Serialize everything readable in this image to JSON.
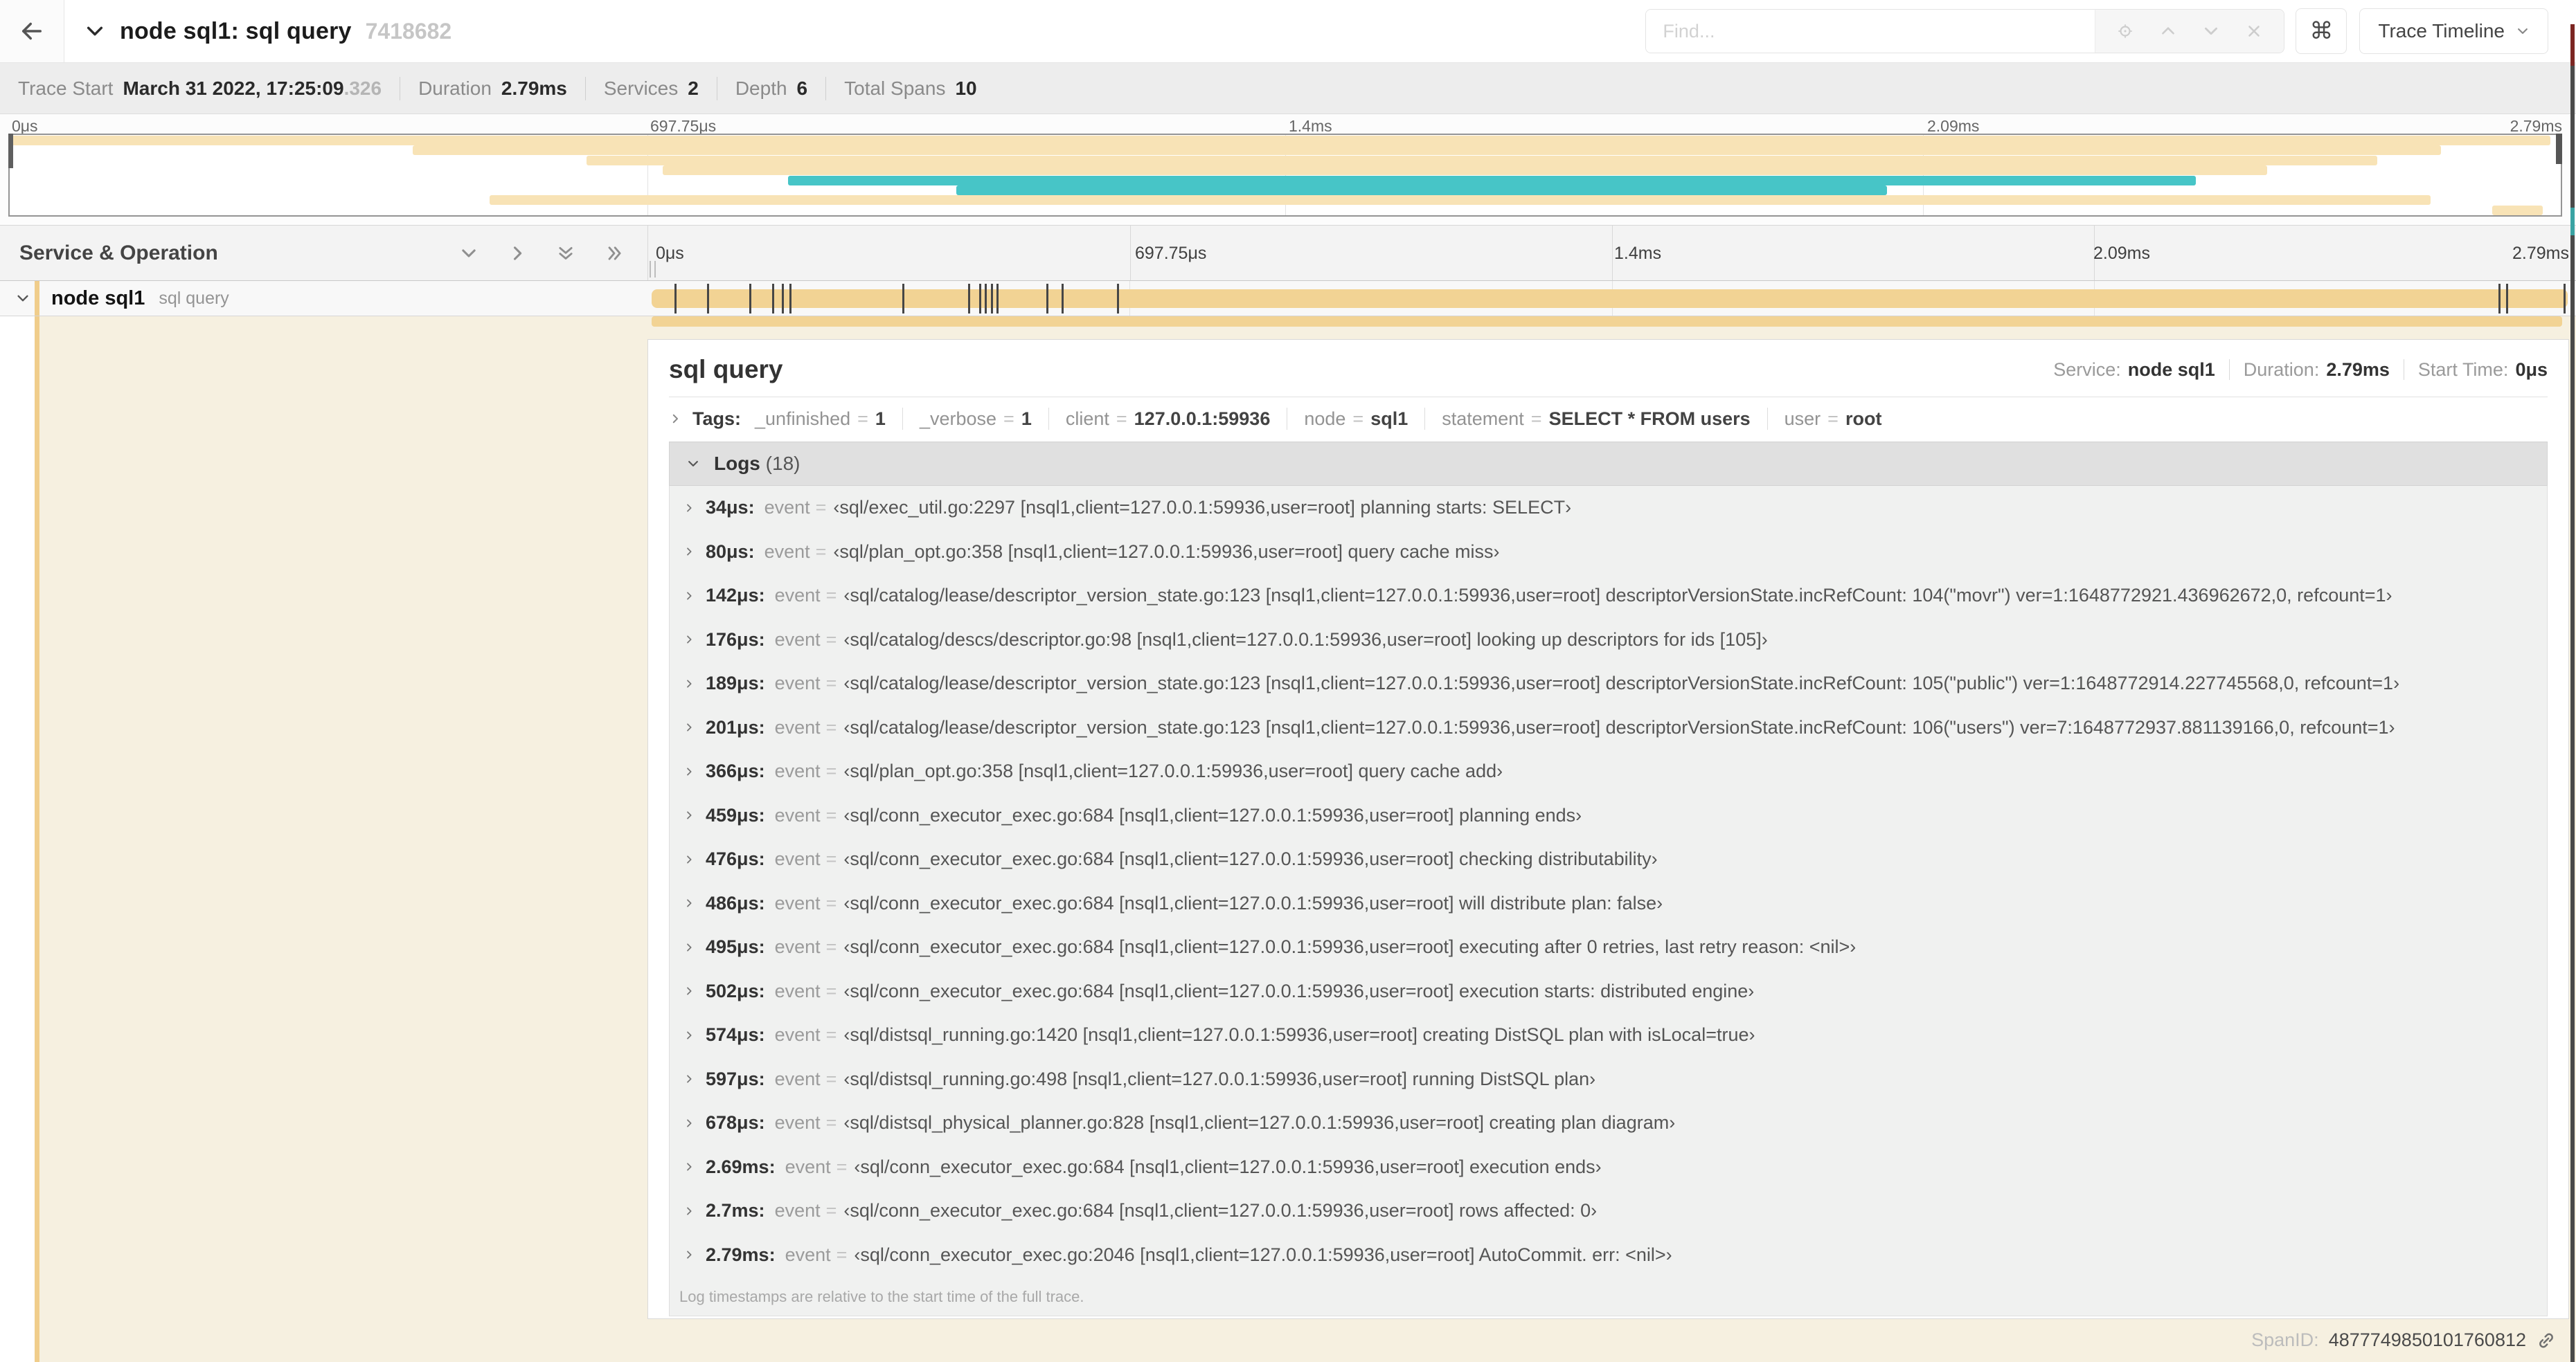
{
  "header": {
    "back": "back",
    "title": "node sql1: sql query",
    "trace_id": "7418682",
    "find_placeholder": "Find...",
    "shortcut": "⌘",
    "view_button": "Trace Timeline"
  },
  "summary": {
    "items": [
      {
        "label": "Trace Start",
        "value": "March 31 2022, 17:25:09",
        "suffix": ".326"
      },
      {
        "label": "Duration",
        "value": "2.79ms",
        "suffix": ""
      },
      {
        "label": "Services",
        "value": "2",
        "suffix": ""
      },
      {
        "label": "Depth",
        "value": "6",
        "suffix": ""
      },
      {
        "label": "Total Spans",
        "value": "10",
        "suffix": ""
      }
    ]
  },
  "timeline_axis": {
    "labels": [
      "0μs",
      "697.75μs",
      "1.4ms",
      "2.09ms",
      "2.79ms"
    ],
    "pcts": [
      0,
      25,
      50,
      75,
      100
    ]
  },
  "minimap": {
    "spans": [
      {
        "row": 0,
        "start": 0,
        "end": 99.6,
        "color": "tan"
      },
      {
        "row": 1,
        "start": 15.8,
        "end": 95.3,
        "color": "tan"
      },
      {
        "row": 2,
        "start": 22.6,
        "end": 92.8,
        "color": "tan"
      },
      {
        "row": 3,
        "start": 25.6,
        "end": 88.5,
        "color": "tan"
      },
      {
        "row": 4,
        "start": 30.5,
        "end": 85.7,
        "color": "teal"
      },
      {
        "row": 5,
        "start": 37.1,
        "end": 73.6,
        "color": "teal"
      },
      {
        "row": 6,
        "start": 18.8,
        "end": 94.9,
        "color": "tan"
      },
      {
        "row": 7,
        "start": 97.3,
        "end": 99.3,
        "color": "tan"
      }
    ]
  },
  "columns": {
    "title": "Service & Operation"
  },
  "span_row": {
    "service": "node sql1",
    "operation": "sql query",
    "ticks_pct": [
      1.2,
      2.9,
      5.1,
      6.3,
      6.8,
      7.2,
      13.1,
      16.5,
      17.1,
      17.4,
      17.7,
      18.0,
      20.6,
      21.4,
      24.3,
      96.4,
      96.8,
      99.8
    ]
  },
  "detail": {
    "title": "sql query",
    "meta": [
      {
        "label": "Service:",
        "value": "node sql1"
      },
      {
        "label": "Duration:",
        "value": "2.79ms"
      },
      {
        "label": "Start Time:",
        "value": "0μs"
      }
    ],
    "tags": {
      "label": "Tags:",
      "eq": "=",
      "items": [
        {
          "key": "_unfinished",
          "value": "1"
        },
        {
          "key": "_verbose",
          "value": "1"
        },
        {
          "key": "client",
          "value": "127.0.0.1:59936"
        },
        {
          "key": "node",
          "value": "sql1"
        },
        {
          "key": "statement",
          "value": "SELECT * FROM users"
        },
        {
          "key": "user",
          "value": "root"
        }
      ]
    },
    "logs": {
      "label": "Logs",
      "count": "(18)",
      "key": "event",
      "eq": "=",
      "items": [
        {
          "time": "34μs:",
          "value": "‹sql/exec_util.go:2297 [nsql1,client=127.0.0.1:59936,user=root] planning starts: SELECT›"
        },
        {
          "time": "80μs:",
          "value": "‹sql/plan_opt.go:358 [nsql1,client=127.0.0.1:59936,user=root] query cache miss›"
        },
        {
          "time": "142μs:",
          "value": "‹sql/catalog/lease/descriptor_version_state.go:123 [nsql1,client=127.0.0.1:59936,user=root] descriptorVersionState.incRefCount: 104(\"movr\") ver=1:1648772921.436962672,0, refcount=1›"
        },
        {
          "time": "176μs:",
          "value": "‹sql/catalog/descs/descriptor.go:98 [nsql1,client=127.0.0.1:59936,user=root] looking up descriptors for ids [105]›"
        },
        {
          "time": "189μs:",
          "value": "‹sql/catalog/lease/descriptor_version_state.go:123 [nsql1,client=127.0.0.1:59936,user=root] descriptorVersionState.incRefCount: 105(\"public\") ver=1:1648772914.227745568,0, refcount=1›"
        },
        {
          "time": "201μs:",
          "value": "‹sql/catalog/lease/descriptor_version_state.go:123 [nsql1,client=127.0.0.1:59936,user=root] descriptorVersionState.incRefCount: 106(\"users\") ver=7:1648772937.881139166,0, refcount=1›"
        },
        {
          "time": "366μs:",
          "value": "‹sql/plan_opt.go:358 [nsql1,client=127.0.0.1:59936,user=root] query cache add›"
        },
        {
          "time": "459μs:",
          "value": "‹sql/conn_executor_exec.go:684 [nsql1,client=127.0.0.1:59936,user=root] planning ends›"
        },
        {
          "time": "476μs:",
          "value": "‹sql/conn_executor_exec.go:684 [nsql1,client=127.0.0.1:59936,user=root] checking distributability›"
        },
        {
          "time": "486μs:",
          "value": "‹sql/conn_executor_exec.go:684 [nsql1,client=127.0.0.1:59936,user=root] will distribute plan: false›"
        },
        {
          "time": "495μs:",
          "value": "‹sql/conn_executor_exec.go:684 [nsql1,client=127.0.0.1:59936,user=root] executing after 0 retries, last retry reason: <nil>›"
        },
        {
          "time": "502μs:",
          "value": "‹sql/conn_executor_exec.go:684 [nsql1,client=127.0.0.1:59936,user=root] execution starts: distributed engine›"
        },
        {
          "time": "574μs:",
          "value": "‹sql/distsql_running.go:1420 [nsql1,client=127.0.0.1:59936,user=root] creating DistSQL plan with isLocal=true›"
        },
        {
          "time": "597μs:",
          "value": "‹sql/distsql_running.go:498 [nsql1,client=127.0.0.1:59936,user=root] running DistSQL plan›"
        },
        {
          "time": "678μs:",
          "value": "‹sql/distsql_physical_planner.go:828 [nsql1,client=127.0.0.1:59936,user=root] creating plan diagram›"
        },
        {
          "time": "2.69ms:",
          "value": "‹sql/conn_executor_exec.go:684 [nsql1,client=127.0.0.1:59936,user=root] execution ends›"
        },
        {
          "time": "2.7ms:",
          "value": "‹sql/conn_executor_exec.go:684 [nsql1,client=127.0.0.1:59936,user=root] rows affected: 0›"
        },
        {
          "time": "2.79ms:",
          "value": "‹sql/conn_executor_exec.go:2046 [nsql1,client=127.0.0.1:59936,user=root] AutoCommit. err: <nil>›"
        }
      ],
      "footnote": "Log timestamps are relative to the start time of the full trace."
    },
    "spanid_label": "SpanID:",
    "spanid": "4877749850101760812"
  },
  "colors": {
    "tan": "#f2d394",
    "tan_light": "#f8e3b6",
    "teal": "#47c5c7",
    "accent": "#f0cd8b",
    "cream": "#f6f0e0",
    "edge_red": "#7c2622",
    "edge_gray": "#4a4a4a",
    "edge_teal": "#3aa3a3"
  }
}
